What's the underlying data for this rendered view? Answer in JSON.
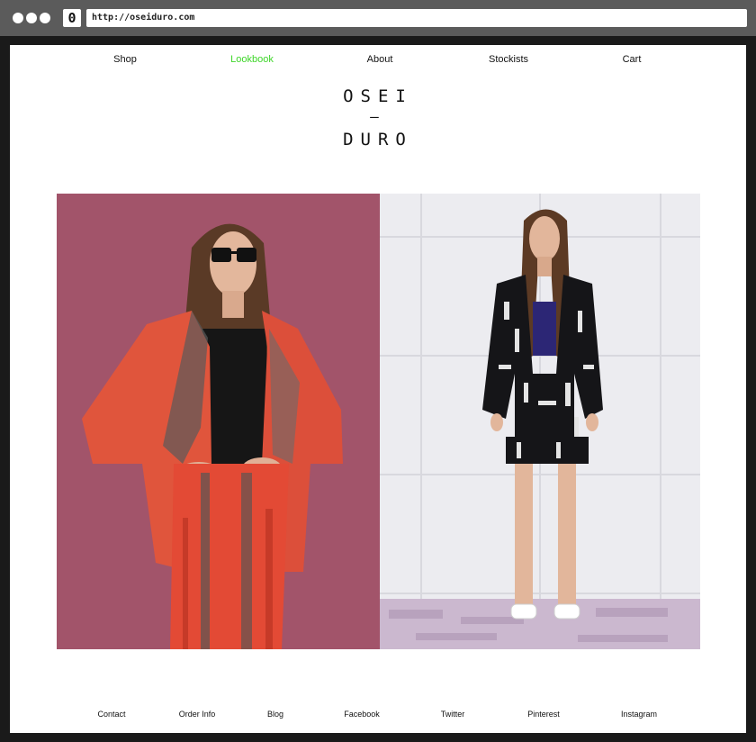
{
  "browser": {
    "url": "http://oseiduro.com",
    "favicon_glyph": "0"
  },
  "nav": {
    "items": [
      {
        "label": "Shop"
      },
      {
        "label": "Lookbook",
        "active": true
      },
      {
        "label": "About"
      },
      {
        "label": "Stockists"
      },
      {
        "label": "Cart"
      }
    ],
    "active_color": "#3fd62a"
  },
  "logo": {
    "line1": "OSEI",
    "line2": "–",
    "line3": "DURO"
  },
  "lookbook": {
    "images": [
      {
        "name": "model in red and grey printed jacket and trousers with sunglasses on pink background"
      },
      {
        "name": "model in black and white printed jacket and shorts with white sandals on white tiled background"
      }
    ]
  },
  "footer": {
    "items": [
      {
        "label": "Contact"
      },
      {
        "label": "Order Info"
      },
      {
        "label": "Blog"
      },
      {
        "label": "Facebook"
      },
      {
        "label": "Twitter"
      },
      {
        "label": "Pinterest"
      },
      {
        "label": "Instagram"
      }
    ]
  }
}
